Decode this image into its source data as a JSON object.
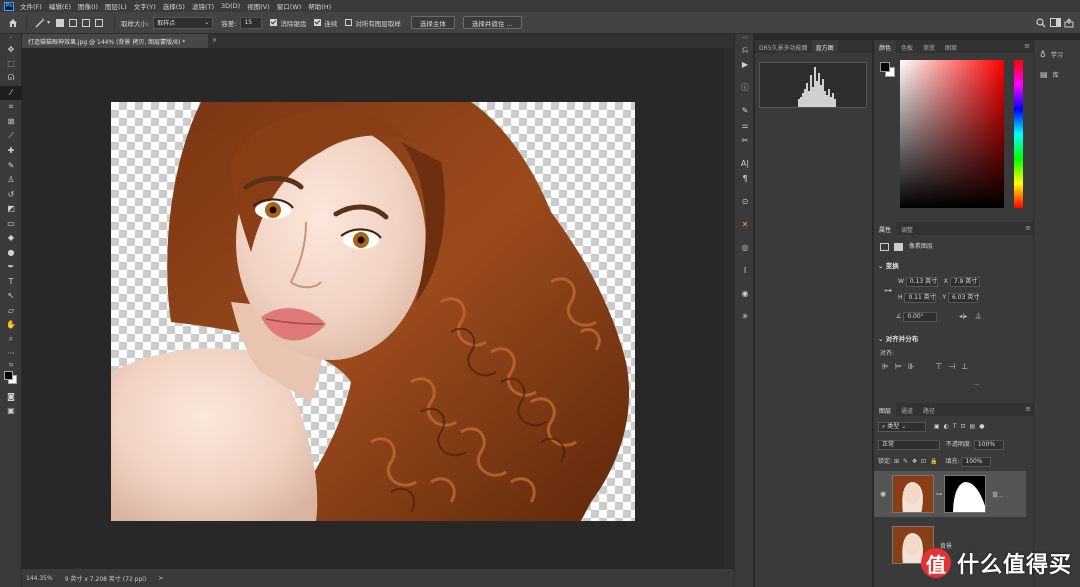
{
  "menubar": {
    "logo": "Ps",
    "items": [
      "文件(F)",
      "编辑(E)",
      "图像(I)",
      "图层(L)",
      "文字(Y)",
      "选择(S)",
      "滤镜(T)",
      "3D(D)",
      "视图(V)",
      "窗口(W)",
      "帮助(H)"
    ]
  },
  "options": {
    "sample_size_label": "取样大小:",
    "sample_size_value": "取样点",
    "tolerance_label": "容差:",
    "tolerance_value": "15",
    "antialias_label": "消除锯齿",
    "contiguous_label": "连续",
    "sample_all_label": "对所有图层取样",
    "select_subject_label": "选择主体",
    "select_mask_label": "选择并遮住 ..."
  },
  "document": {
    "tab_title": "打造猫猫眼神效果.jpg @ 144% (背景 拷贝, 图层蒙版/8) *",
    "close": "×"
  },
  "status": {
    "zoom": "144.35%",
    "dimensions": "9 英寸 x 7.208 英寸 (72 ppi)",
    "arrow": ">"
  },
  "histogram_panel": {
    "tabs": [
      "DR5久景多功能面",
      "直方图"
    ],
    "active": 1
  },
  "color_panel": {
    "tabs": [
      "颜色",
      "色板",
      "渐变",
      "图案"
    ],
    "fg_color": "#000000",
    "bg_color": "#ffffff"
  },
  "properties_panel": {
    "tabs": [
      "属性",
      "调整"
    ],
    "layer_type": "像素图层",
    "transform_title": "变换",
    "w_label": "W",
    "w_value": "0.13 英寸",
    "x_label": "X",
    "x_value": "7.9 英寸",
    "h_label": "H",
    "h_value": "0.11 英寸",
    "y_label": "Y",
    "y_value": "6.03 英寸",
    "angle_value": "0.00°",
    "align_title": "对齐并分布",
    "align_label": "对齐:",
    "more": "..."
  },
  "layers_panel": {
    "tabs": [
      "图层",
      "通道",
      "路径"
    ],
    "filter_label": "类型",
    "blend_mode": "正常",
    "opacity_label": "不透明度:",
    "opacity_value": "100%",
    "lock_label": "锁定:",
    "fill_label": "填充:",
    "fill_value": "100%",
    "layers": [
      {
        "name": "背...",
        "visible": true,
        "selected": true
      },
      {
        "name": "背景",
        "visible": false,
        "selected": false
      }
    ]
  },
  "far_right": {
    "items": [
      {
        "icon": "bulb-icon",
        "label": "学习"
      },
      {
        "icon": "library-icon",
        "label": "库"
      }
    ]
  },
  "watermark": {
    "logo": "值",
    "text": "什么值得买"
  }
}
